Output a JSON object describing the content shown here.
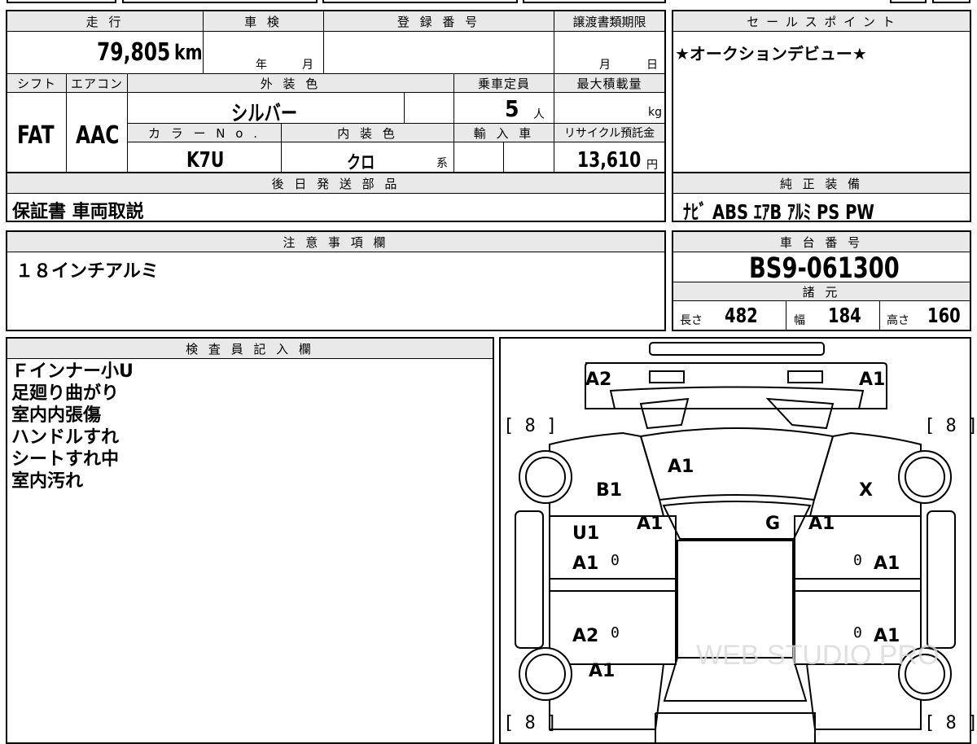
{
  "headers": {
    "mileage": "走 行",
    "inspection": "車 検",
    "registration": "登 録 番 号",
    "transfer_deadline": "譲渡書類期限",
    "sales_point": "セ ー ル ス ポ イ ン ト",
    "shift": "シフト",
    "aircon": "エアコン",
    "exterior_color": "外 装 色",
    "capacity": "乗車定員",
    "max_load": "最大積載量",
    "color_no": "カ ラ ー N o .",
    "interior_color": "内 装 色",
    "import": "輸 入 車",
    "recycle": "リサイクル預託金",
    "later_parts": "後 日 発 送 部 品",
    "genuine_equipment": "純 正 装 備",
    "notes": "注 意 事 項 欄",
    "chassis": "車 台 番 号",
    "specs": "諸 元",
    "inspector": "検 査 員 記 入 欄"
  },
  "values": {
    "mileage": "79,805",
    "mileage_unit": "km",
    "inspection_year": "年",
    "inspection_month": "月",
    "transfer_month": "月",
    "transfer_day": "日",
    "sales_point": "★オークションデビュー★",
    "shift": "FAT",
    "aircon": "AAC",
    "exterior_color": "シルバー",
    "capacity": "5",
    "capacity_unit": "人",
    "max_load_unit": "kg",
    "color_no": "K7U",
    "interior_color": "クロ",
    "interior_suffix": "系",
    "recycle": "13,610",
    "recycle_unit": "円",
    "later_parts": "保証書 車両取説",
    "genuine_equipment": "ﾅﾋﾞ ABS ｴｱB ｱﾙﾐ PS PW",
    "notes": "１８インチアルミ",
    "chassis": "BS9-061300",
    "length_label": "長さ",
    "length": "482",
    "width_label": "幅",
    "width": "184",
    "height_label": "高さ",
    "height": "160"
  },
  "inspector_notes": [
    "Ｆインナー小U",
    "足廻り曲がり",
    "室内内張傷",
    "ハンドルすれ",
    "シートすれ中",
    "室内汚れ"
  ],
  "diagram": {
    "tire_tl": "[ 8 ]",
    "tire_tr": "[ 8 ]",
    "tire_bl": "[ 8 ]",
    "tire_br": "[ 8 ]",
    "front_bumper_left": "A2",
    "front_bumper_right": "A1",
    "hood": "A1",
    "left_front_fender": "B1",
    "right_front_fender": "X",
    "left_a_pillar": "A1",
    "windshield": "G",
    "right_a_pillar": "A1",
    "left_front_door_a": "U1",
    "left_front_door_b": "A1",
    "left_front_door_num": "0",
    "right_front_door_num": "0",
    "right_front_door": "A1",
    "left_rear_door": "A2",
    "left_rear_door_num": "0",
    "right_rear_door_num": "0",
    "right_rear_door": "A1",
    "left_rear_fender": "A1",
    "watermark": "WEB STUDIO PRO"
  }
}
